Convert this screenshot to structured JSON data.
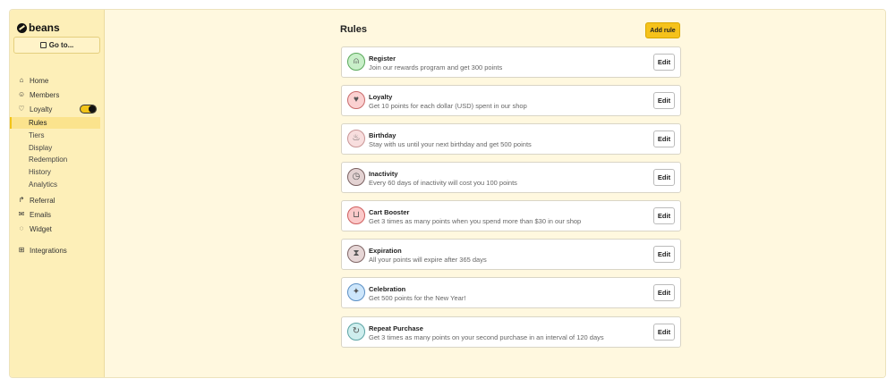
{
  "sidebar": {
    "brand": "beans",
    "goto_label": "Go to...",
    "nav_top": [
      {
        "label": "Home",
        "icon": "home-icon"
      },
      {
        "label": "Members",
        "icon": "user-icon"
      }
    ],
    "loyalty": {
      "label": "Loyalty",
      "icon": "heart-icon",
      "toggle_on": true
    },
    "loyalty_sub": [
      {
        "label": "Rules",
        "active": true
      },
      {
        "label": "Tiers",
        "active": false
      },
      {
        "label": "Display",
        "active": false
      },
      {
        "label": "Redemption",
        "active": false
      },
      {
        "label": "History",
        "active": false
      },
      {
        "label": "Analytics",
        "active": false
      }
    ],
    "nav_bottom": [
      {
        "label": "Referral",
        "icon": "share-arrow-icon"
      },
      {
        "label": "Emails",
        "icon": "mail-icon"
      },
      {
        "label": "Widget",
        "icon": "chat-bubble-icon"
      }
    ],
    "integrations": {
      "label": "Integrations",
      "icon": "grid-icon"
    }
  },
  "main": {
    "title": "Rules",
    "add_rule_label": "Add rule",
    "edit_label": "Edit",
    "rules": [
      {
        "title": "Register",
        "desc": "Join our rewards program and get 300 points",
        "icon": "person-icon",
        "color": "#c8efc8",
        "border": "#5aa85a"
      },
      {
        "title": "Loyalty",
        "desc": "Get 10 points for each dollar (USD) spent in our shop",
        "icon": "heart-icon",
        "color": "#fbd1d1",
        "border": "#c96a6a"
      },
      {
        "title": "Birthday",
        "desc": "Stay with us until your next birthday and get 500 points",
        "icon": "cake-icon",
        "color": "#f8dede",
        "border": "#c99494"
      },
      {
        "title": "Inactivity",
        "desc": "Every 60 days of inactivity will cost you 100 points",
        "icon": "stopwatch-icon",
        "color": "#e3d2d2",
        "border": "#7a6060"
      },
      {
        "title": "Cart Booster",
        "desc": "Get 3 times as many points when you spend more than $30 in our shop",
        "icon": "cart-icon",
        "color": "#fbc9c9",
        "border": "#cf5d5d"
      },
      {
        "title": "Expiration",
        "desc": "All your points will expire after 365 days",
        "icon": "hourglass-icon",
        "color": "#e6d6d6",
        "border": "#806666"
      },
      {
        "title": "Celebration",
        "desc": "Get 500 points for the New Year!",
        "icon": "party-popper-icon",
        "color": "#cde6fb",
        "border": "#5b8fc4"
      },
      {
        "title": "Repeat Purchase",
        "desc": "Get 3 times as many points on your second purchase in an interval of 120 days",
        "icon": "repeat-icon",
        "color": "#cfeeee",
        "border": "#5aa3a3"
      }
    ]
  }
}
